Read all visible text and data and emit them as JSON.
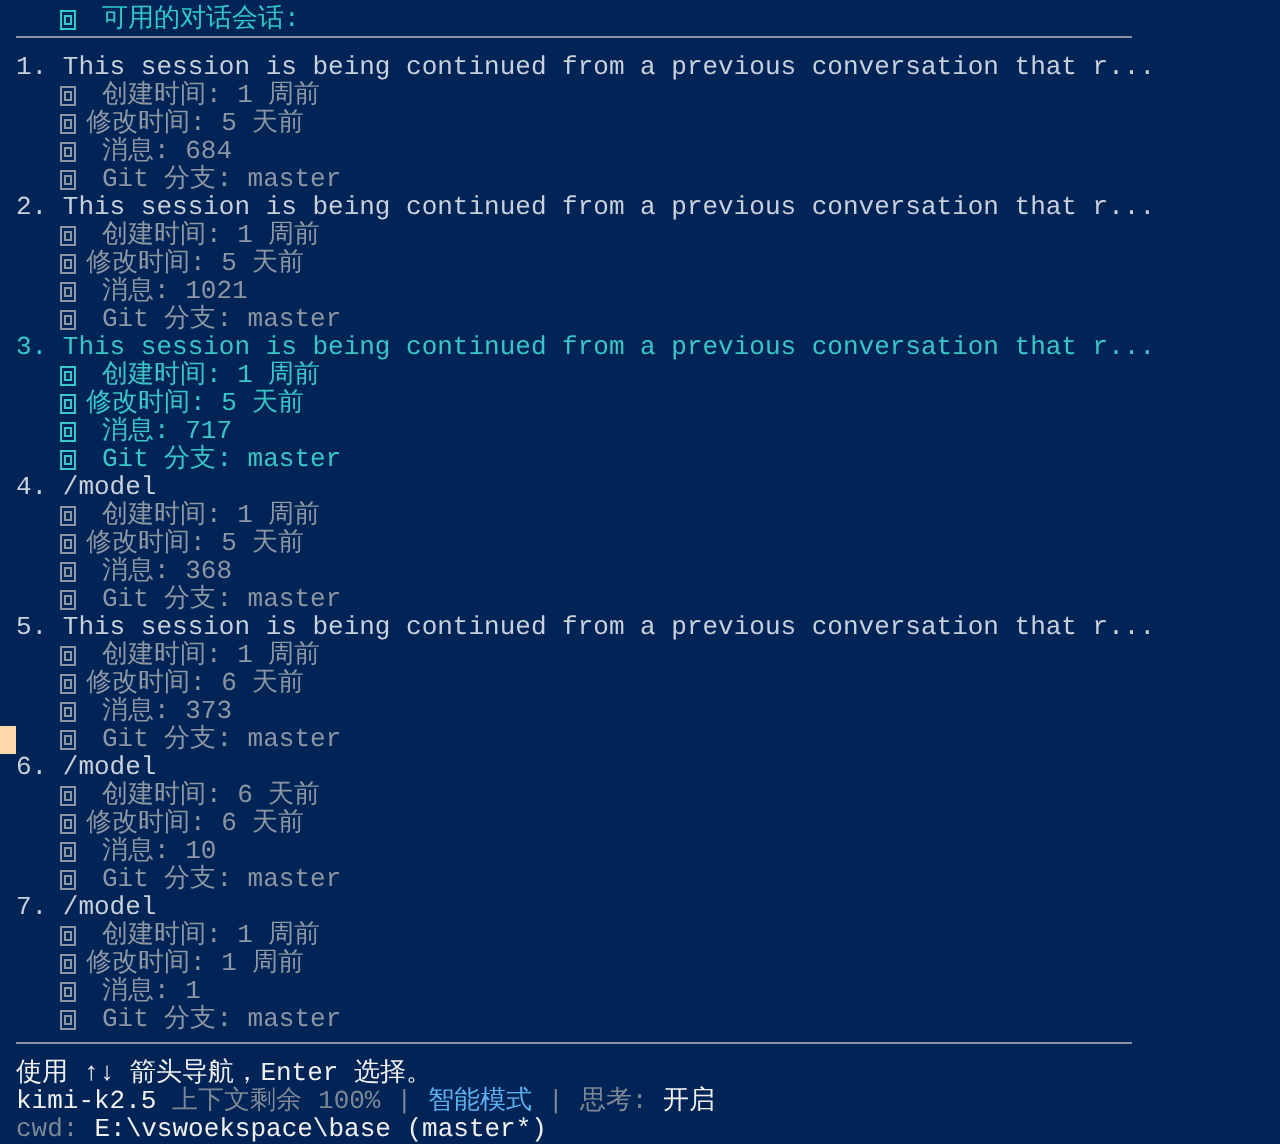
{
  "header": {
    "title": "可用的对话会话:"
  },
  "sessions": [
    {
      "number": "1.",
      "title": "This session is being continued from a previous conversation that r...",
      "selected": false,
      "meta": [
        "创建时间: 1 周前",
        "修改时间: 5 天前",
        "消息: 684",
        "Git 分支: master"
      ]
    },
    {
      "number": "2.",
      "title": "This session is being continued from a previous conversation that r...",
      "selected": false,
      "meta": [
        "创建时间: 1 周前",
        "修改时间: 5 天前",
        "消息: 1021",
        "Git 分支: master"
      ]
    },
    {
      "number": "3.",
      "title": "This session is being continued from a previous conversation that r...",
      "selected": true,
      "meta": [
        "创建时间: 1 周前",
        "修改时间: 5 天前",
        "消息: 717",
        "Git 分支: master"
      ]
    },
    {
      "number": "4.",
      "title": "/model",
      "selected": false,
      "meta": [
        "创建时间: 1 周前",
        "修改时间: 5 天前",
        "消息: 368",
        "Git 分支: master"
      ]
    },
    {
      "number": "5.",
      "title": "This session is being continued from a previous conversation that r...",
      "selected": false,
      "cursor": true,
      "meta": [
        "创建时间: 1 周前",
        "修改时间: 6 天前",
        "消息: 373",
        "Git 分支: master"
      ]
    },
    {
      "number": "6.",
      "title": "/model",
      "selected": false,
      "meta": [
        "创建时间: 6 天前",
        "修改时间: 6 天前",
        "消息: 10",
        "Git 分支: master"
      ]
    },
    {
      "number": "7.",
      "title": "/model",
      "selected": false,
      "meta": [
        "创建时间: 1 周前",
        "修改时间: 1 周前",
        "消息: 1",
        "Git 分支: master"
      ]
    }
  ],
  "help": "使用 ↑↓ 箭头导航，Enter 选择。",
  "status": {
    "model": "kimi-k2.5",
    "context": "上下文剩余 100%",
    "separator": "|",
    "mode": "智能模式",
    "thinking_label": "思考:",
    "thinking_value": "开启"
  },
  "cwd": {
    "label": "cwd:",
    "path": "E:\\vswoekspace\\base (master*)"
  }
}
